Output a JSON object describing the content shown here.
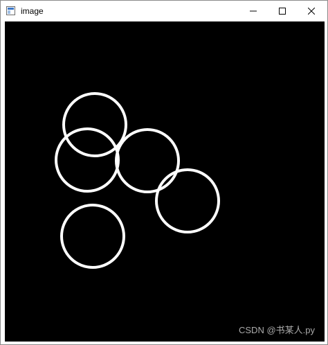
{
  "window": {
    "title": "image",
    "icons": {
      "app": "app-window-icon",
      "minimize": "minimize-icon",
      "maximize": "maximize-icon",
      "close": "close-icon"
    }
  },
  "canvas": {
    "background_color": "#000000",
    "stroke_color": "#ffffff",
    "shapes": [
      {
        "type": "circle",
        "name": "circle-top-left"
      },
      {
        "type": "circle",
        "name": "circle-middle-left"
      },
      {
        "type": "circle",
        "name": "circle-middle"
      },
      {
        "type": "circle",
        "name": "circle-right"
      },
      {
        "type": "circle",
        "name": "circle-bottom-left"
      }
    ]
  },
  "watermark": {
    "text": "CSDN @书某人.py"
  }
}
